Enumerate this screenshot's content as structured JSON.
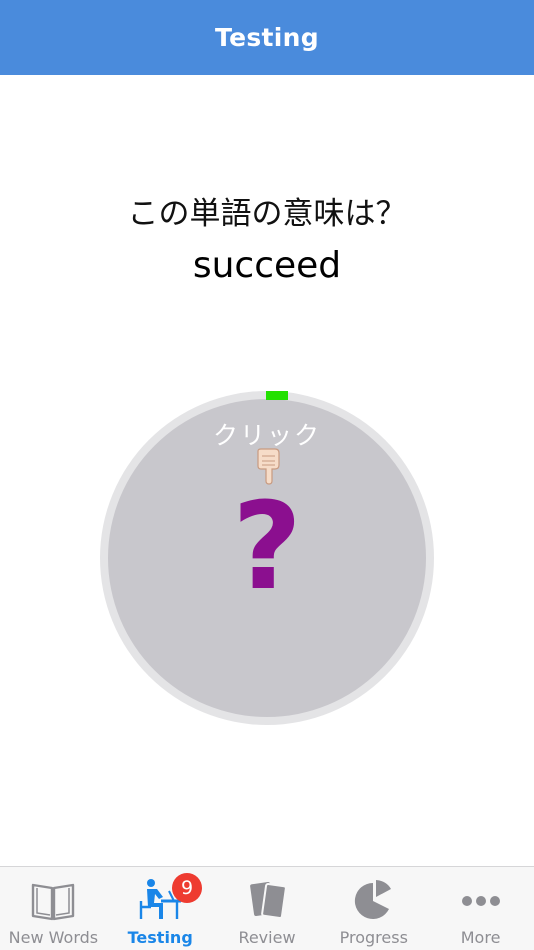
{
  "nav": {
    "title": "Testing"
  },
  "quiz": {
    "prompt": "この単語の意味は？",
    "word": "succeed",
    "card_hint": "クリック",
    "card_symbol": "?"
  },
  "colors": {
    "nav_bar": "#4a8bdc",
    "card_fill": "#c8c7cc",
    "card_ring": "#e4e4e6",
    "progress_marker": "#22e000",
    "question_mark": "#8b0f8f",
    "active_tab": "#1a86e8",
    "inactive_tab": "#8e8e93",
    "badge": "#ee3b30"
  },
  "icons": {
    "hint": "pointing-down-hand-icon",
    "new_words": "open-book-icon",
    "testing": "student-at-desk-icon",
    "review": "cards-icon",
    "progress": "pie-chart-icon",
    "more": "ellipsis-icon"
  },
  "tabbar": {
    "tabs": [
      {
        "label": "New Words",
        "icon": "open-book-icon",
        "active": false
      },
      {
        "label": "Testing",
        "icon": "student-at-desk-icon",
        "active": true,
        "badge": "9"
      },
      {
        "label": "Review",
        "icon": "cards-icon",
        "active": false
      },
      {
        "label": "Progress",
        "icon": "pie-chart-icon",
        "active": false
      },
      {
        "label": "More",
        "icon": "ellipsis-icon",
        "active": false
      }
    ]
  }
}
